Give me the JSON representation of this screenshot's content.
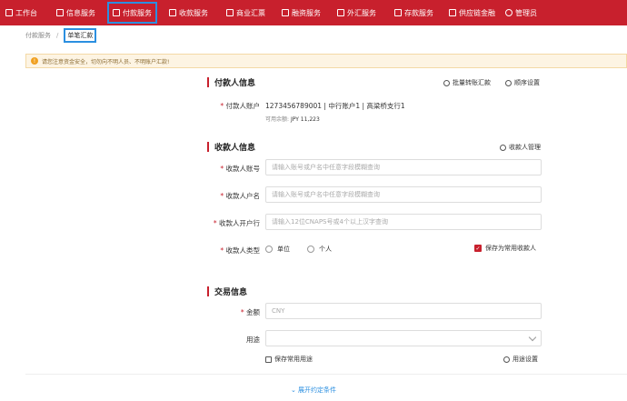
{
  "nav": {
    "items": [
      {
        "label": "工作台"
      },
      {
        "label": "信息服务"
      },
      {
        "label": "付款服务"
      },
      {
        "label": "收款服务"
      },
      {
        "label": "商业汇票"
      },
      {
        "label": "融资服务"
      },
      {
        "label": "外汇服务"
      },
      {
        "label": "存款服务"
      },
      {
        "label": "供应链金融"
      },
      {
        "label": "管理员"
      }
    ]
  },
  "breadcrumb": {
    "parent": "付款服务",
    "separator": "/",
    "current": "单笔汇款"
  },
  "notice": "请您注意资金安全，切勿向不明人员、不明账户汇款!",
  "payer": {
    "title": "付款人信息",
    "batch_link": "批量转账汇款",
    "order_link": "顺序设置",
    "account_label": "付款人账户",
    "account_value": "1273456789001 | 中行账户1 | 高梁桥支行1",
    "balance_label": "可用余额:",
    "balance_value": "JPY 11,223"
  },
  "payee": {
    "title": "收款人信息",
    "manage_link": "收款人管理",
    "account_label": "收款人账号",
    "account_placeholder": "请输入账号或户名中任意字段模糊查询",
    "name_label": "收款人户名",
    "name_placeholder": "请输入账号或户名中任意字段模糊查询",
    "bank_label": "收款人开户行",
    "bank_placeholder": "请输入12位CNAPS号或4个以上汉字查询",
    "type_label": "收款人类型",
    "type_option1": "单位",
    "type_option2": "个人",
    "save_common": "保存为常用收款人"
  },
  "trade": {
    "title": "交易信息",
    "amount_label": "金额",
    "amount_placeholder": "CNY",
    "purpose_label": "用途",
    "save_purpose": "保存常用用途",
    "purpose_settings": "用途设置"
  },
  "expand": "展开约定条件",
  "colors": {
    "brand": "#c8202d",
    "highlight": "#2b8fe0"
  }
}
